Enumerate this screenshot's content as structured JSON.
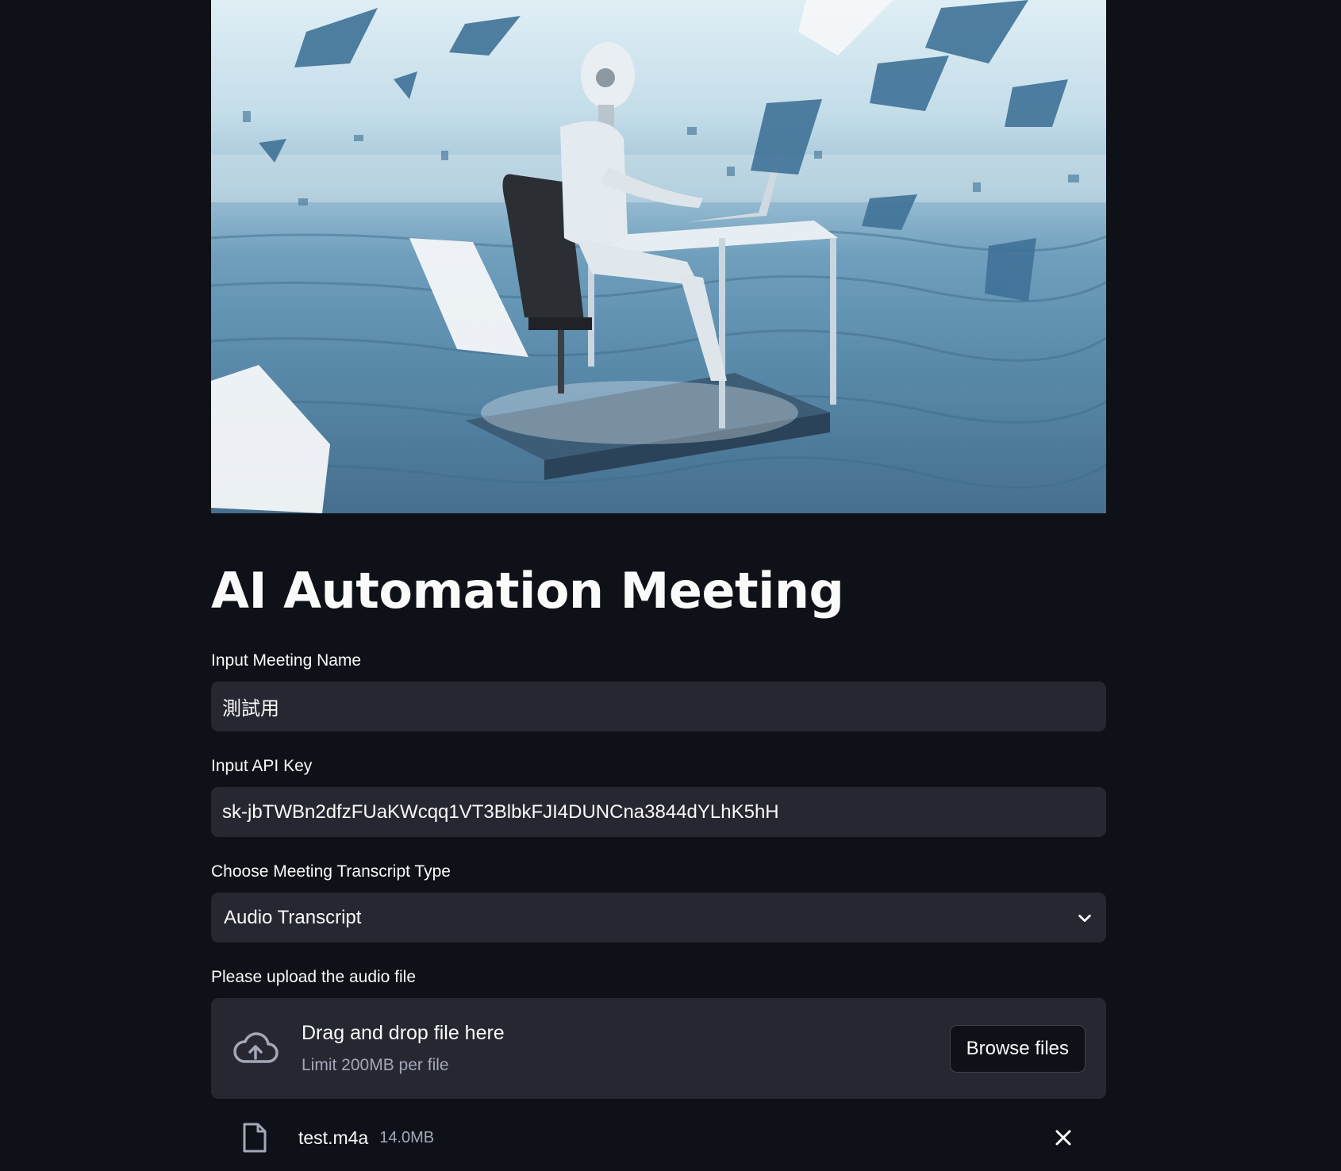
{
  "title": "AI Automation Meeting",
  "meeting_name": {
    "label": "Input Meeting Name",
    "value": "測試用"
  },
  "api_key": {
    "label": "Input API Key",
    "value": "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"
  },
  "transcript_type": {
    "label": "Choose Meeting Transcript Type",
    "selected": "Audio Transcript"
  },
  "upload": {
    "label": "Please upload the audio file",
    "drop_text": "Drag and drop file here",
    "limit_text": "Limit 200MB per file",
    "browse_label": "Browse files"
  },
  "uploaded_file": {
    "name": "test.m4a",
    "size": "14.0MB"
  },
  "icons": {
    "upload": "cloud-upload-icon",
    "dropdown": "chevron-down-icon",
    "file": "file-icon",
    "remove": "close-icon"
  },
  "colors": {
    "background": "#0e1117",
    "input_bg": "#262730",
    "text": "#fafafa",
    "muted": "#a3a8b8"
  }
}
